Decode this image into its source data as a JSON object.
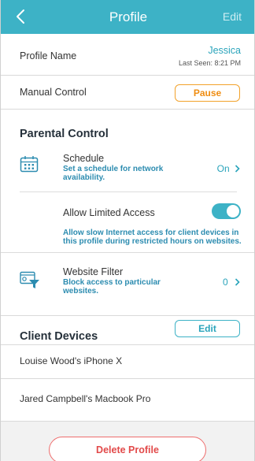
{
  "header": {
    "title": "Profile",
    "edit_label": "Edit",
    "back_icon": "chevron-left-icon"
  },
  "profile": {
    "name_label": "Profile Name",
    "name_value": "Jessica",
    "last_seen": "Last Seen: 8:21 PM"
  },
  "manual_control": {
    "label": "Manual Control",
    "button_label": "Pause"
  },
  "parental_control": {
    "title": "Parental Control",
    "schedule": {
      "title": "Schedule",
      "desc_line1": "Set a schedule for network",
      "desc_line2": "availability.",
      "value": "On",
      "icon": "calendar-icon"
    },
    "limited_access": {
      "title": "Allow Limited Access",
      "enabled": true,
      "desc_line1": "Allow slow Internet access for client devices in",
      "desc_line2": "this profile during restricted hours on websites."
    },
    "website_filter": {
      "title": "Website Filter",
      "desc_line1": "Block access to particular",
      "desc_line2": "websites.",
      "value": "0",
      "icon": "website-filter-icon"
    }
  },
  "client_devices": {
    "title": "Client Devices",
    "edit_label": "Edit",
    "items": [
      {
        "label": "Louise Wood's iPhone X"
      },
      {
        "label": "Jared Campbell's Macbook Pro"
      }
    ]
  },
  "delete_label": "Delete Profile",
  "colors": {
    "accent": "#3db2c6",
    "warning": "#ef8d12",
    "danger": "#e24a4a"
  }
}
